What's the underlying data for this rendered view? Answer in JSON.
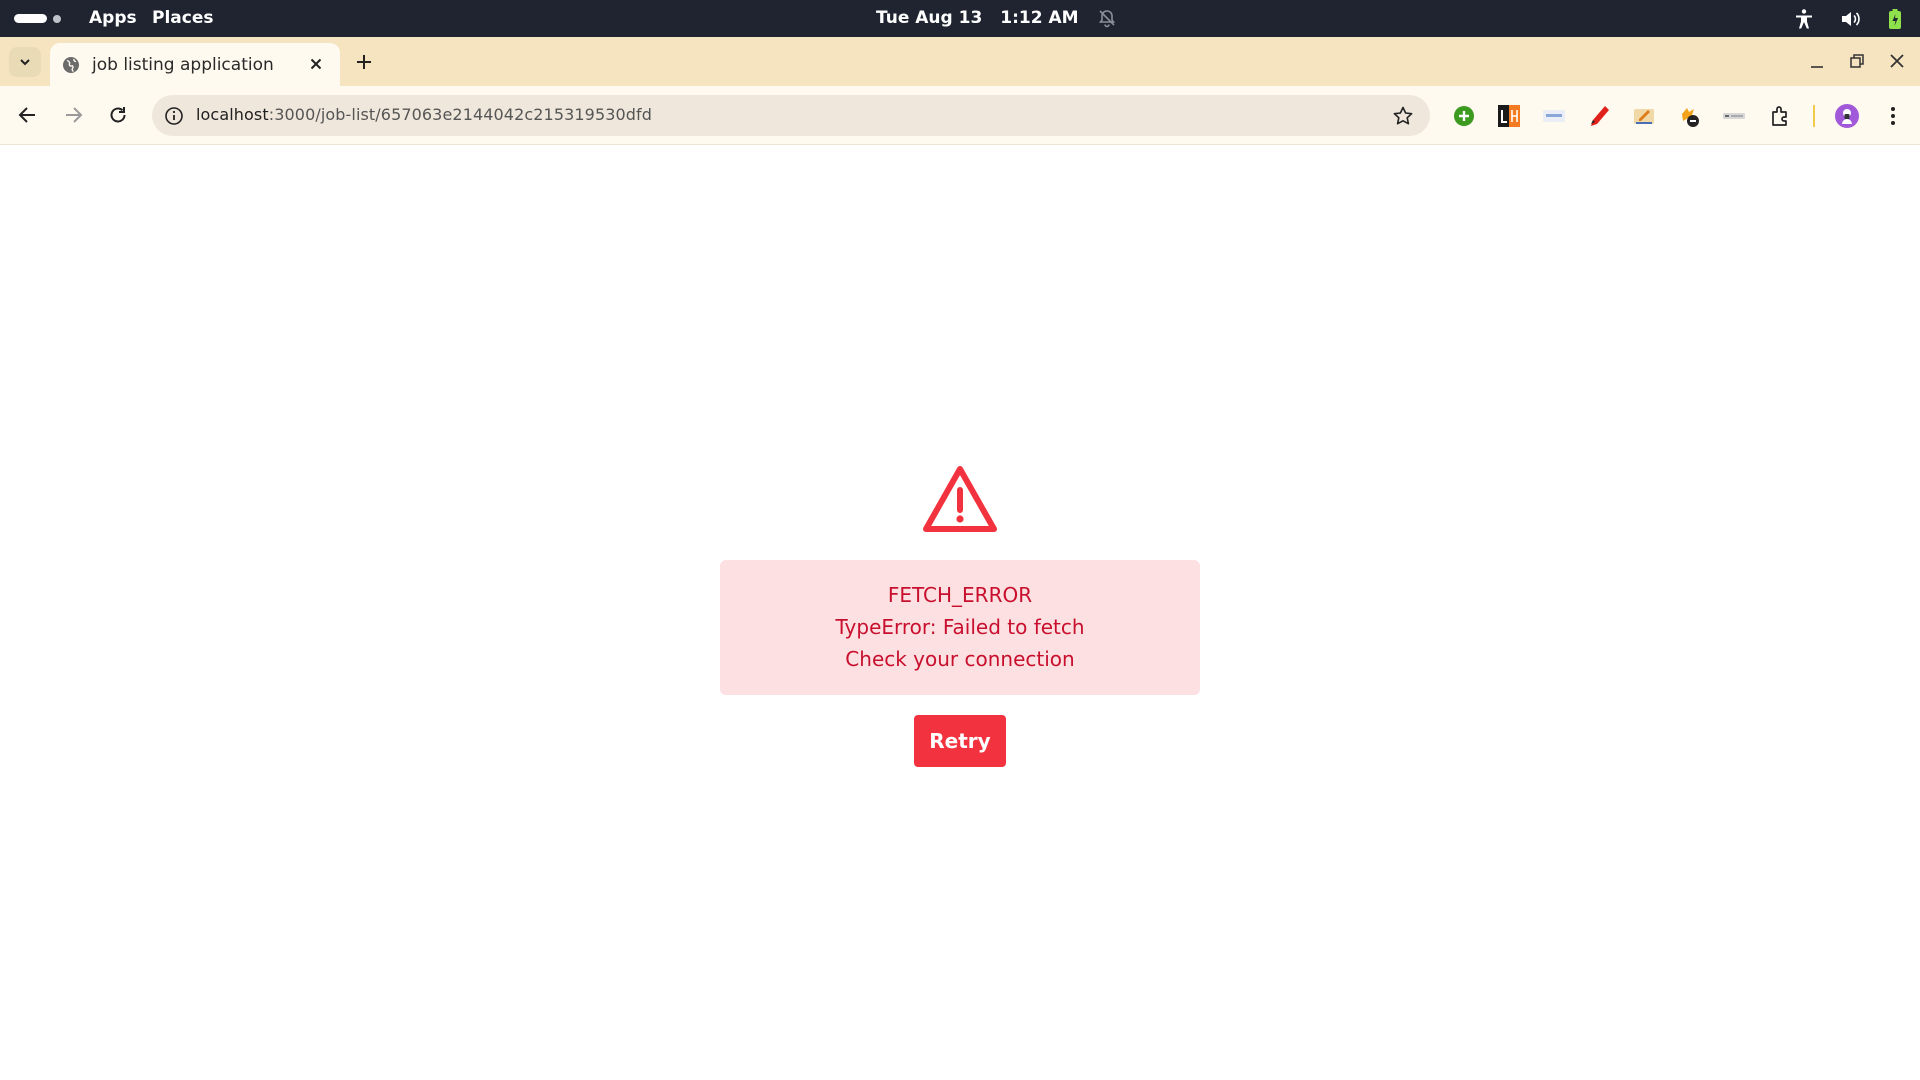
{
  "system_bar": {
    "apps_label": "Apps",
    "places_label": "Places",
    "date": "Tue Aug 13",
    "time": "1:12 AM"
  },
  "browser": {
    "tab": {
      "title": "job listing application"
    },
    "address": {
      "host": "localhost",
      "path": ":3000/job-list/657063e2144042c215319530dfd"
    }
  },
  "page": {
    "error": {
      "code": "FETCH_ERROR",
      "message": "TypeError: Failed to fetch",
      "hint": "Check your connection"
    },
    "retry_label": "Retry"
  },
  "colors": {
    "error_text": "#c8102e",
    "error_bg": "#fde0e1",
    "button_bg": "#f2333f",
    "tabstrip_bg": "#f6e3bf"
  },
  "icons": [
    "activities-icon",
    "notifications-off-icon",
    "accessibility-icon",
    "volume-icon",
    "battery-icon",
    "tab-search-icon",
    "globe-icon",
    "close-icon",
    "plus-icon",
    "minimize-icon",
    "restore-icon",
    "window-close-icon",
    "back-icon",
    "forward-icon",
    "reload-icon",
    "info-icon",
    "star-icon",
    "extensions-icon",
    "profile-avatar",
    "more-icon",
    "warning-icon"
  ]
}
